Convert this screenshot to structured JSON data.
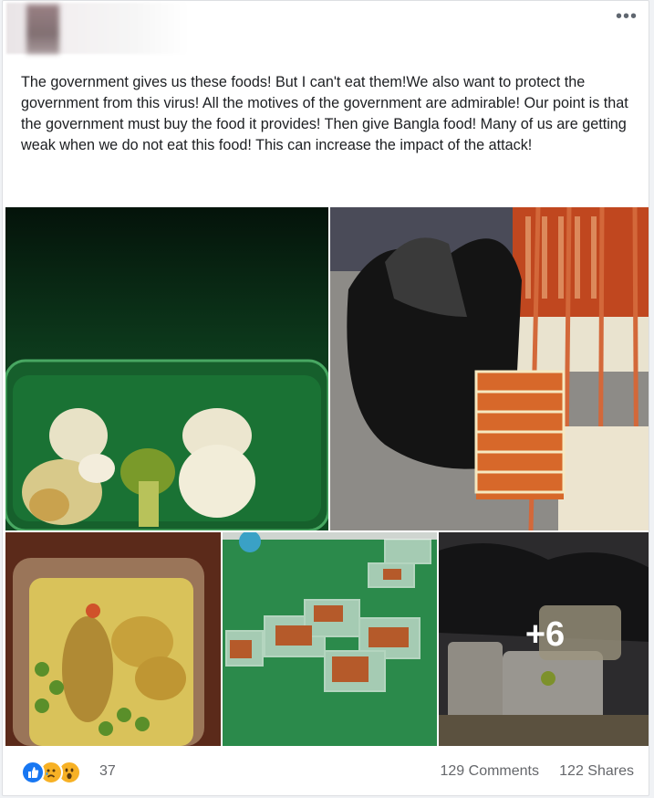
{
  "post": {
    "text": "The government gives us these foods! But I can't eat them!We also want to protect the government from this virus! All the motives of the government are admirable! Our point is that the government must buy the food it provides! Then give Bangla food! Many of us are getting weak when we do not eat this food! This can increase the impact of the attack!",
    "more_options_label": "•••",
    "photos": [
      {
        "name": "cauliflower-broccoli-in-green-container"
      },
      {
        "name": "food-containers-stacked-by-garbage-bags"
      },
      {
        "name": "rice-vegetables-in-plastic-box"
      },
      {
        "name": "small-food-trays-on-green-table"
      },
      {
        "name": "discarded-food-boxes-in-bag",
        "more_count": "+6"
      }
    ]
  },
  "footer": {
    "reaction_icons": [
      "like-icon",
      "sad-icon",
      "wow-icon"
    ],
    "reaction_count": "37",
    "comments": "129 Comments",
    "shares": "122 Shares"
  }
}
